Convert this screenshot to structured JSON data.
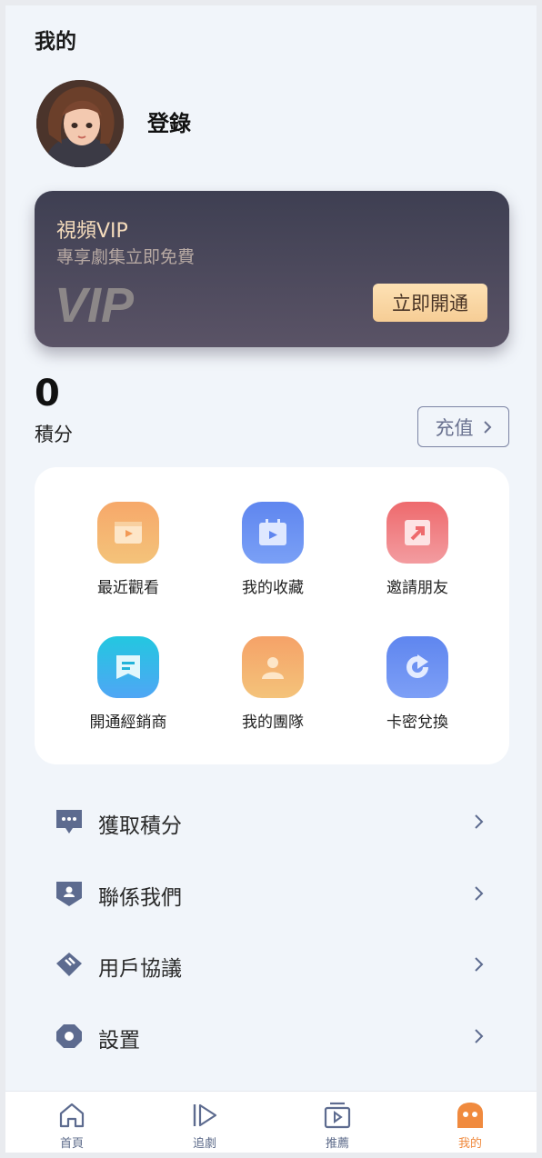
{
  "header": {
    "title": "我的"
  },
  "profile": {
    "login_label": "登錄"
  },
  "vip": {
    "title": "視頻VIP",
    "subtitle": "專享劇集立即免費",
    "logo_text": "VIP",
    "open_button": "立即開通"
  },
  "points": {
    "value": "0",
    "label": "積分",
    "recharge_button": "充值"
  },
  "grid": [
    {
      "label": "最近觀看",
      "icon": "recent-watch-icon"
    },
    {
      "label": "我的收藏",
      "icon": "favorites-icon"
    },
    {
      "label": "邀請朋友",
      "icon": "invite-icon"
    },
    {
      "label": "開通經銷商",
      "icon": "dealer-icon"
    },
    {
      "label": "我的團隊",
      "icon": "team-icon"
    },
    {
      "label": "卡密兌換",
      "icon": "redeem-icon"
    }
  ],
  "menu": [
    {
      "label": "獲取積分",
      "icon": "chat-bubble-icon"
    },
    {
      "label": "聯係我們",
      "icon": "contact-icon"
    },
    {
      "label": "用戶協議",
      "icon": "agreement-icon"
    },
    {
      "label": "設置",
      "icon": "settings-icon"
    }
  ],
  "tabs": [
    {
      "label": "首頁",
      "icon": "home-icon"
    },
    {
      "label": "追劇",
      "icon": "play-icon"
    },
    {
      "label": "推薦",
      "icon": "recommend-icon"
    },
    {
      "label": "我的",
      "icon": "profile-icon",
      "active": true
    }
  ],
  "colors": {
    "accent": "#f08a3e",
    "vip_gold": "#f5dcbc",
    "menu_icon": "#5d6b8f",
    "background": "#f1f5fa"
  }
}
